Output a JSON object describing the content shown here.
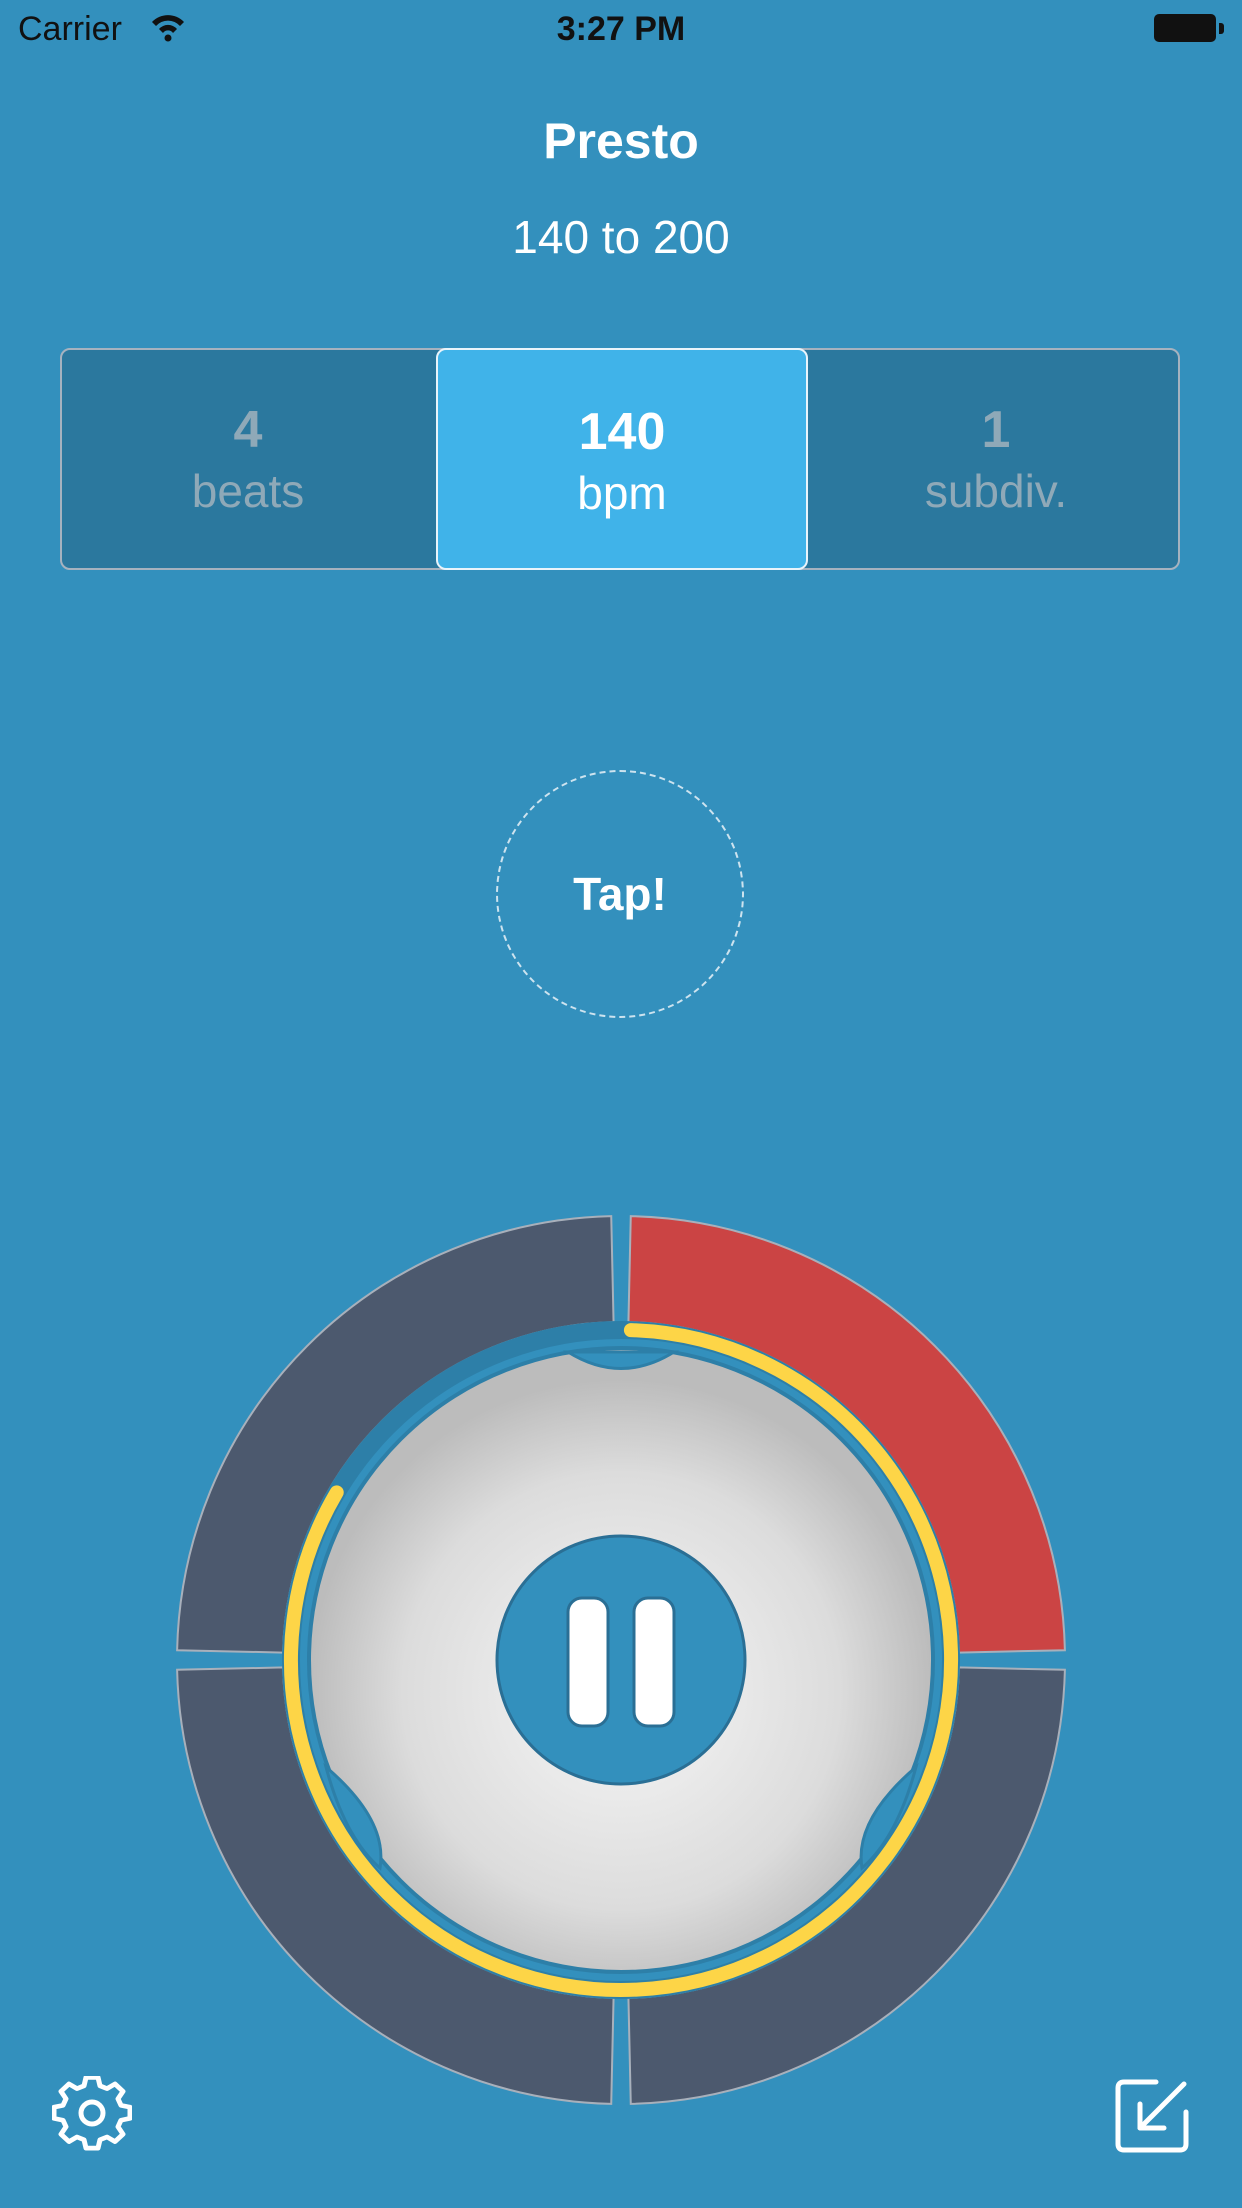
{
  "status_bar": {
    "carrier": "Carrier",
    "time": "3:27 PM"
  },
  "tempo": {
    "name": "Presto",
    "range": "140 to 200"
  },
  "segments": [
    {
      "value": "4",
      "label": "beats",
      "selected": false
    },
    {
      "value": "140",
      "label": "bpm",
      "selected": true
    },
    {
      "value": "1",
      "label": "subdiv.",
      "selected": false
    }
  ],
  "tap_label": "Tap!",
  "beat_wheel": {
    "beats": 4,
    "active_beat": 1,
    "playback_progress": 0.83
  },
  "icons": {
    "pause": "pause-icon",
    "settings": "gear-icon",
    "collapse": "collapse-arrow-icon"
  },
  "colors": {
    "background": "#3390bd",
    "selected_segment": "#40b3e9",
    "active_beat": "#cb4444",
    "inactive_beat": "#4c596e",
    "progress_ring": "#fdd547"
  }
}
